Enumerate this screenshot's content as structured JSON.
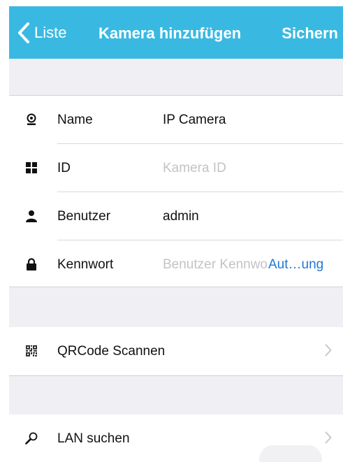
{
  "navbar": {
    "back_label": "Liste",
    "title": "Kamera hinzufügen",
    "save_label": "Sichern",
    "color": "#39b9e2"
  },
  "form": {
    "name": {
      "label": "Name",
      "value": "IP Camera",
      "icon": "webcam-icon"
    },
    "id": {
      "label": "ID",
      "placeholder": "Kamera ID",
      "icon": "grid-icon"
    },
    "user": {
      "label": "Benutzer",
      "value": "admin",
      "icon": "user-icon"
    },
    "password": {
      "label": "Kennwort",
      "placeholder": "Benutzer Kennwort",
      "autofill_label": "Aut…ung",
      "icon": "lock-icon"
    }
  },
  "actions": {
    "qr": {
      "label": "QRCode Scannen",
      "icon": "qr-code-icon"
    },
    "lan": {
      "label": "LAN suchen",
      "icon": "search-icon"
    }
  },
  "colors": {
    "separator_bg": "#efeff4",
    "link": "#1c79d9",
    "placeholder": "#c3c3c8"
  }
}
